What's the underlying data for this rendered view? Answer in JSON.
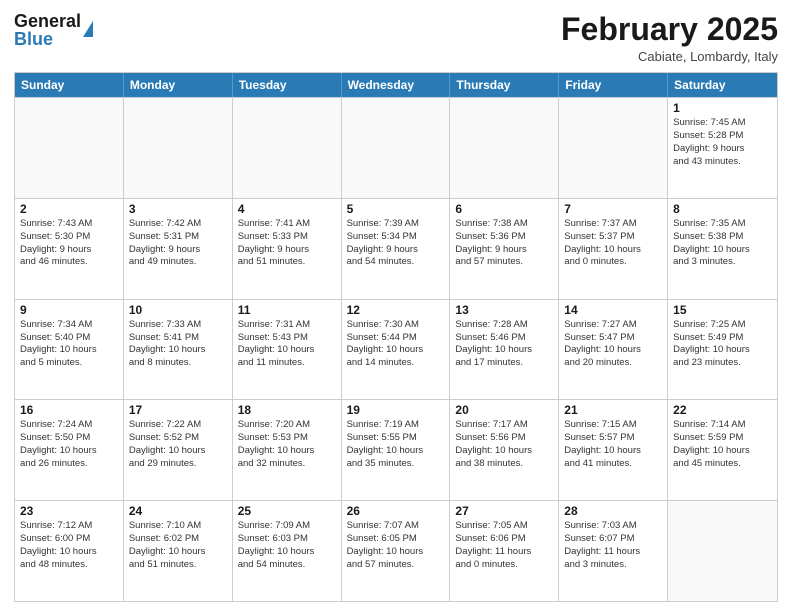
{
  "header": {
    "logo_general": "General",
    "logo_blue": "Blue",
    "month_title": "February 2025",
    "location": "Cabiate, Lombardy, Italy"
  },
  "calendar": {
    "days_of_week": [
      "Sunday",
      "Monday",
      "Tuesday",
      "Wednesday",
      "Thursday",
      "Friday",
      "Saturday"
    ],
    "rows": [
      [
        {
          "day": "",
          "info": "",
          "empty": true
        },
        {
          "day": "",
          "info": "",
          "empty": true
        },
        {
          "day": "",
          "info": "",
          "empty": true
        },
        {
          "day": "",
          "info": "",
          "empty": true
        },
        {
          "day": "",
          "info": "",
          "empty": true
        },
        {
          "day": "",
          "info": "",
          "empty": true
        },
        {
          "day": "1",
          "info": "Sunrise: 7:45 AM\nSunset: 5:28 PM\nDaylight: 9 hours\nand 43 minutes.",
          "empty": false
        }
      ],
      [
        {
          "day": "2",
          "info": "Sunrise: 7:43 AM\nSunset: 5:30 PM\nDaylight: 9 hours\nand 46 minutes.",
          "empty": false
        },
        {
          "day": "3",
          "info": "Sunrise: 7:42 AM\nSunset: 5:31 PM\nDaylight: 9 hours\nand 49 minutes.",
          "empty": false
        },
        {
          "day": "4",
          "info": "Sunrise: 7:41 AM\nSunset: 5:33 PM\nDaylight: 9 hours\nand 51 minutes.",
          "empty": false
        },
        {
          "day": "5",
          "info": "Sunrise: 7:39 AM\nSunset: 5:34 PM\nDaylight: 9 hours\nand 54 minutes.",
          "empty": false
        },
        {
          "day": "6",
          "info": "Sunrise: 7:38 AM\nSunset: 5:36 PM\nDaylight: 9 hours\nand 57 minutes.",
          "empty": false
        },
        {
          "day": "7",
          "info": "Sunrise: 7:37 AM\nSunset: 5:37 PM\nDaylight: 10 hours\nand 0 minutes.",
          "empty": false
        },
        {
          "day": "8",
          "info": "Sunrise: 7:35 AM\nSunset: 5:38 PM\nDaylight: 10 hours\nand 3 minutes.",
          "empty": false
        }
      ],
      [
        {
          "day": "9",
          "info": "Sunrise: 7:34 AM\nSunset: 5:40 PM\nDaylight: 10 hours\nand 5 minutes.",
          "empty": false
        },
        {
          "day": "10",
          "info": "Sunrise: 7:33 AM\nSunset: 5:41 PM\nDaylight: 10 hours\nand 8 minutes.",
          "empty": false
        },
        {
          "day": "11",
          "info": "Sunrise: 7:31 AM\nSunset: 5:43 PM\nDaylight: 10 hours\nand 11 minutes.",
          "empty": false
        },
        {
          "day": "12",
          "info": "Sunrise: 7:30 AM\nSunset: 5:44 PM\nDaylight: 10 hours\nand 14 minutes.",
          "empty": false
        },
        {
          "day": "13",
          "info": "Sunrise: 7:28 AM\nSunset: 5:46 PM\nDaylight: 10 hours\nand 17 minutes.",
          "empty": false
        },
        {
          "day": "14",
          "info": "Sunrise: 7:27 AM\nSunset: 5:47 PM\nDaylight: 10 hours\nand 20 minutes.",
          "empty": false
        },
        {
          "day": "15",
          "info": "Sunrise: 7:25 AM\nSunset: 5:49 PM\nDaylight: 10 hours\nand 23 minutes.",
          "empty": false
        }
      ],
      [
        {
          "day": "16",
          "info": "Sunrise: 7:24 AM\nSunset: 5:50 PM\nDaylight: 10 hours\nand 26 minutes.",
          "empty": false
        },
        {
          "day": "17",
          "info": "Sunrise: 7:22 AM\nSunset: 5:52 PM\nDaylight: 10 hours\nand 29 minutes.",
          "empty": false
        },
        {
          "day": "18",
          "info": "Sunrise: 7:20 AM\nSunset: 5:53 PM\nDaylight: 10 hours\nand 32 minutes.",
          "empty": false
        },
        {
          "day": "19",
          "info": "Sunrise: 7:19 AM\nSunset: 5:55 PM\nDaylight: 10 hours\nand 35 minutes.",
          "empty": false
        },
        {
          "day": "20",
          "info": "Sunrise: 7:17 AM\nSunset: 5:56 PM\nDaylight: 10 hours\nand 38 minutes.",
          "empty": false
        },
        {
          "day": "21",
          "info": "Sunrise: 7:15 AM\nSunset: 5:57 PM\nDaylight: 10 hours\nand 41 minutes.",
          "empty": false
        },
        {
          "day": "22",
          "info": "Sunrise: 7:14 AM\nSunset: 5:59 PM\nDaylight: 10 hours\nand 45 minutes.",
          "empty": false
        }
      ],
      [
        {
          "day": "23",
          "info": "Sunrise: 7:12 AM\nSunset: 6:00 PM\nDaylight: 10 hours\nand 48 minutes.",
          "empty": false
        },
        {
          "day": "24",
          "info": "Sunrise: 7:10 AM\nSunset: 6:02 PM\nDaylight: 10 hours\nand 51 minutes.",
          "empty": false
        },
        {
          "day": "25",
          "info": "Sunrise: 7:09 AM\nSunset: 6:03 PM\nDaylight: 10 hours\nand 54 minutes.",
          "empty": false
        },
        {
          "day": "26",
          "info": "Sunrise: 7:07 AM\nSunset: 6:05 PM\nDaylight: 10 hours\nand 57 minutes.",
          "empty": false
        },
        {
          "day": "27",
          "info": "Sunrise: 7:05 AM\nSunset: 6:06 PM\nDaylight: 11 hours\nand 0 minutes.",
          "empty": false
        },
        {
          "day": "28",
          "info": "Sunrise: 7:03 AM\nSunset: 6:07 PM\nDaylight: 11 hours\nand 3 minutes.",
          "empty": false
        },
        {
          "day": "",
          "info": "",
          "empty": true
        }
      ]
    ]
  }
}
